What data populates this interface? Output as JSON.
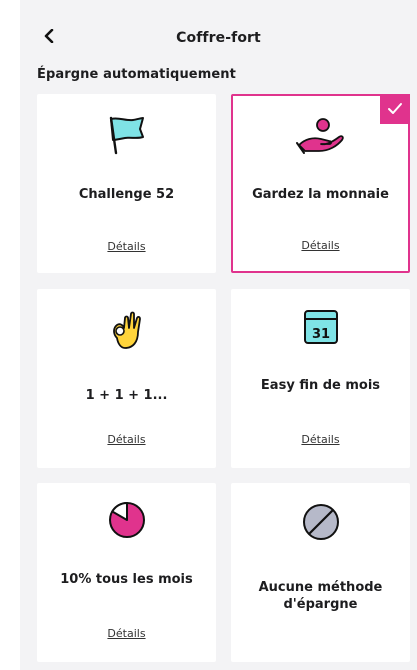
{
  "header": {
    "title": "Coffre-fort",
    "back_icon": "chevron-left-icon"
  },
  "section": {
    "title": "Épargne automatiquement"
  },
  "colors": {
    "accent": "#e0338d",
    "teal": "#7fe3e6",
    "yellow": "#ffd43b",
    "grey_icon": "#b6b9c9"
  },
  "cards": [
    {
      "label": "Challenge 52",
      "details": "Détails",
      "icon": "flag-icon",
      "selected": false
    },
    {
      "label": "Gardez la monnaie",
      "details": "Détails",
      "icon": "hand-coin-icon",
      "selected": true
    },
    {
      "label": "1 + 1 + 1...",
      "details": "Détails",
      "icon": "ok-hand-icon",
      "selected": false
    },
    {
      "label": "Easy fin de mois",
      "details": "Détails",
      "icon": "calendar-icon",
      "icon_text": "31",
      "selected": false
    },
    {
      "label": "10% tous les mois",
      "details": "Détails",
      "icon": "pie-chart-icon",
      "selected": false
    },
    {
      "label": "Aucune méthode d'épargne",
      "details": "",
      "icon": "no-sign-icon",
      "selected": false
    }
  ]
}
